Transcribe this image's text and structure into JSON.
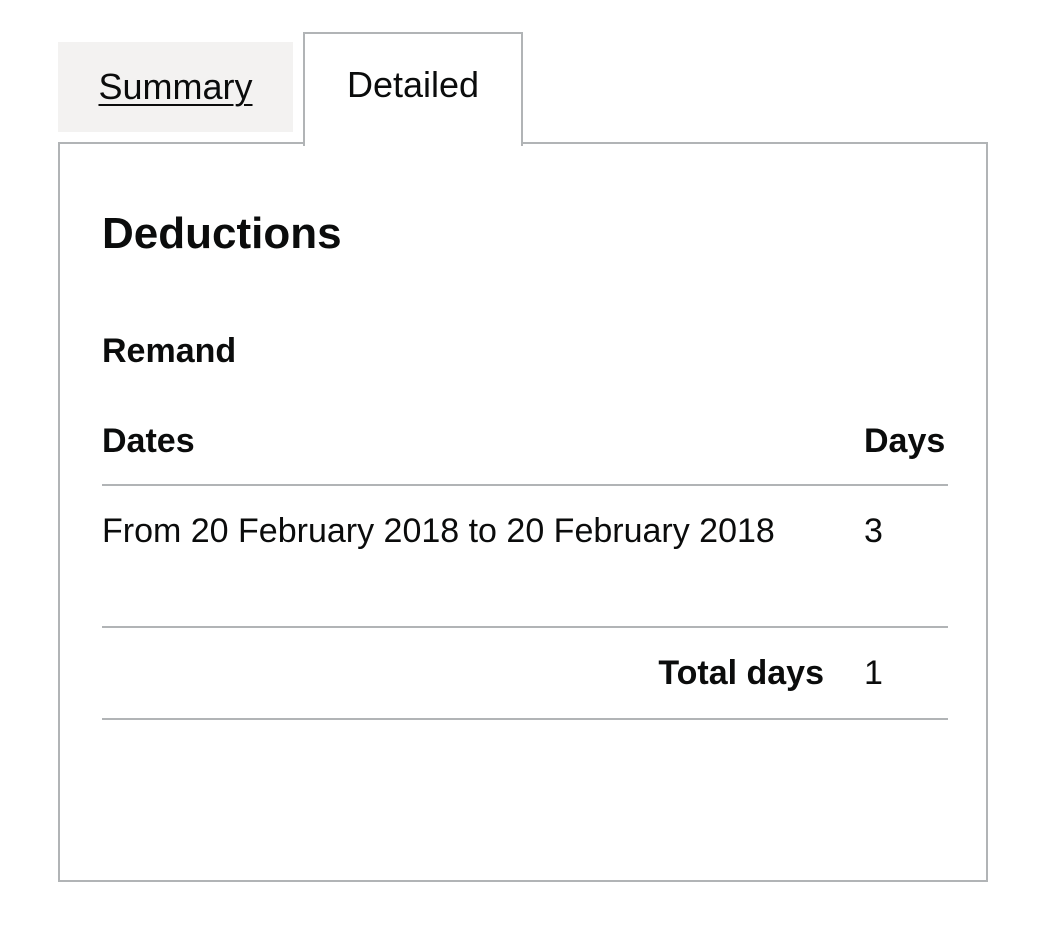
{
  "tabs": [
    {
      "label": "Summary",
      "selected": false
    },
    {
      "label": "Detailed",
      "selected": true
    }
  ],
  "panel": {
    "title": "Deductions",
    "section": {
      "title": "Remand",
      "table": {
        "headers": {
          "dates": "Dates",
          "days": "Days"
        },
        "rows": [
          {
            "dates": "From 20 February 2018 to 20 February 2018",
            "days": "3"
          }
        ],
        "total": {
          "label": "Total days",
          "value": "1"
        }
      }
    }
  },
  "colors": {
    "text": "#0b0c0c",
    "border": "#b1b4b6",
    "inactive_tab_bg": "#f3f2f1",
    "panel_bg": "#ffffff"
  }
}
